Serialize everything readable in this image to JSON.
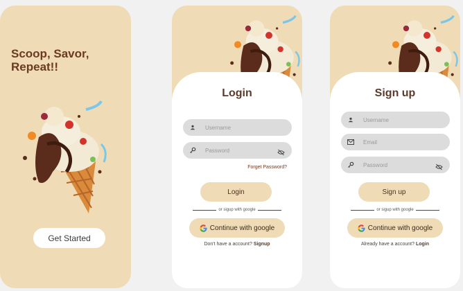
{
  "splash": {
    "title": "Scoop, Savor, Repeat!!",
    "cta": "Get Started"
  },
  "login": {
    "title": "Login",
    "username_placeholder": "Username",
    "password_placeholder": "Password",
    "forgot": "Forget Password?",
    "submit": "Login",
    "divider": "or sigup with google",
    "google": "Continue with google",
    "footer_text": "Don't have a account?",
    "footer_link": "Signup"
  },
  "signup": {
    "title": "Sign up",
    "username_placeholder": "Username",
    "email_placeholder": "Email",
    "password_placeholder": "Password",
    "submit": "Sign up",
    "divider": "or sigup with google",
    "google": "Continue with google",
    "footer_text": "Already have a account?",
    "footer_link": "Login"
  },
  "colors": {
    "cream": "#efdcb7",
    "brown": "#6b3a22",
    "field": "#dcdcdc"
  },
  "icons": [
    "ice-cream-illustration",
    "user-icon",
    "key-icon",
    "eye-off-icon",
    "mail-icon",
    "google-logo-icon"
  ]
}
